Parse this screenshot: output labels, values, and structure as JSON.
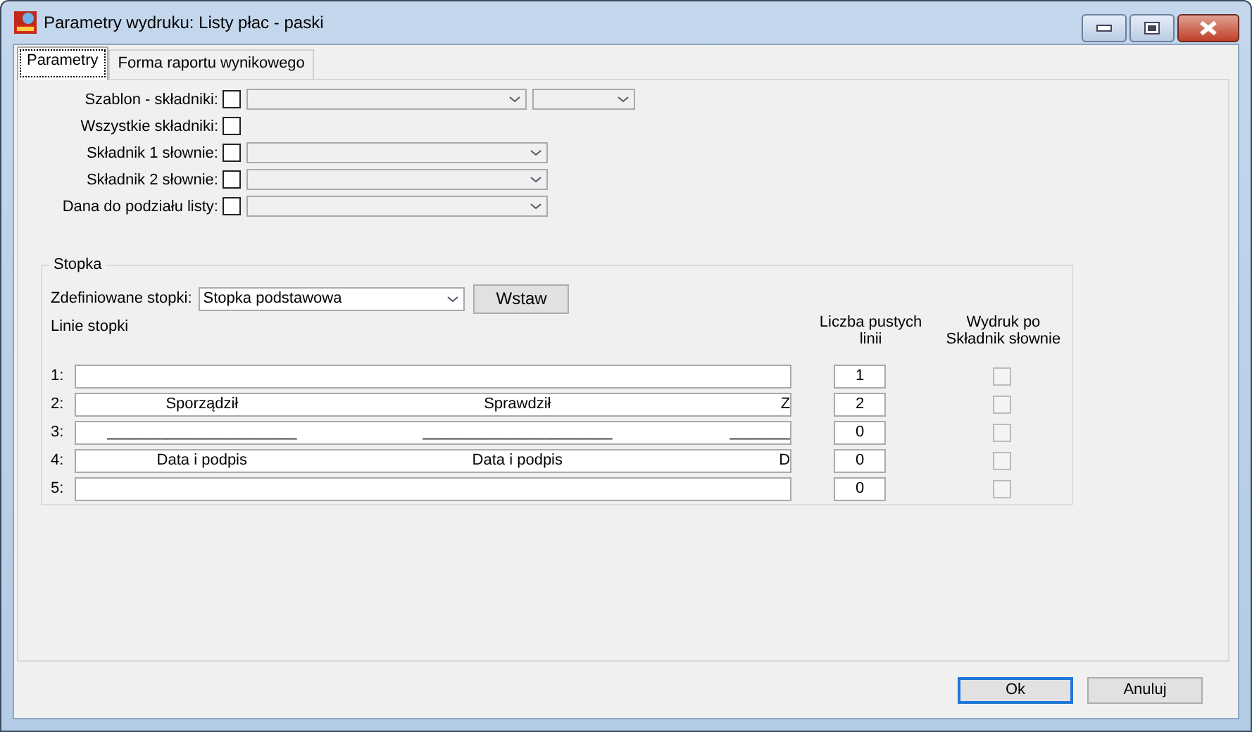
{
  "window": {
    "title": "Parametry wydruku: Listy płac - paski"
  },
  "tabs": [
    {
      "label": "Parametry",
      "selected": true
    },
    {
      "label": "Forma raportu wynikowego",
      "selected": false
    }
  ],
  "parameters": [
    {
      "label": "Szablon - składniki:",
      "checked": false,
      "kind": "double"
    },
    {
      "label": "Wszystkie składniki:",
      "checked": false,
      "kind": "plain"
    },
    {
      "label": "Składnik 1 słownie:",
      "checked": false,
      "kind": "single"
    },
    {
      "label": "Składnik 2 słownie:",
      "checked": false,
      "kind": "single"
    },
    {
      "label": "Dana do podziału listy:",
      "checked": false,
      "kind": "single"
    }
  ],
  "footer": {
    "title": "Stopka",
    "defined_label": "Zdefiniowane stopki:",
    "defined_value": "Stopka podstawowa",
    "insert_button": "Wstaw",
    "lines_label": "Linie stopki",
    "blank_lines_header": "Liczba pustych linii",
    "print_header": "Wydruk po Składnik słownie",
    "lines": [
      {
        "number": "1:",
        "blank_lines": "1",
        "print": false,
        "disabled": true
      },
      {
        "number": "2:",
        "parts": [
          "Sporządził",
          "Sprawdził",
          "Z"
        ],
        "blank_lines": "2",
        "print": false,
        "disabled": true
      },
      {
        "number": "3:",
        "parts": [
          "______________________",
          "______________________",
          "_______"
        ],
        "blank_lines": "0",
        "print": false,
        "disabled": true
      },
      {
        "number": "4:",
        "parts": [
          "Data i podpis",
          "Data i podpis",
          "D"
        ],
        "blank_lines": "0",
        "print": false,
        "disabled": true
      },
      {
        "number": "5:",
        "blank_lines": "0",
        "print": false,
        "disabled": true
      }
    ]
  },
  "buttons": [
    {
      "label": "Ok",
      "kind": "default"
    },
    {
      "label": "Anuluj",
      "kind": "normal"
    }
  ]
}
